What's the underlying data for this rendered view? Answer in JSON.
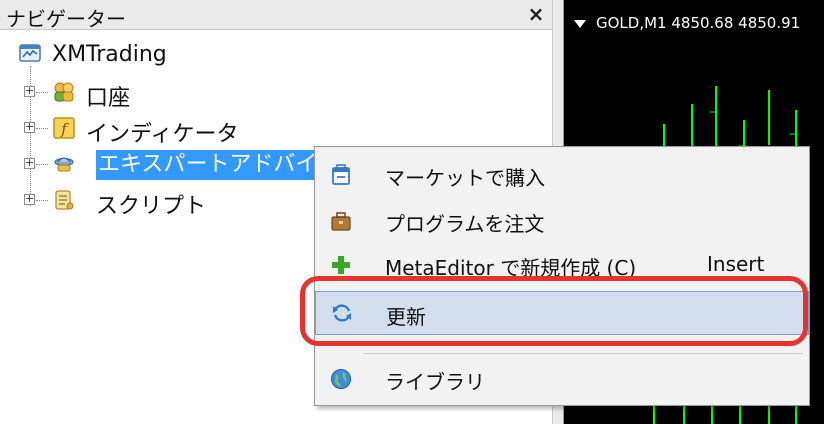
{
  "navigator": {
    "title": "ナビゲーター",
    "close_glyph": "×",
    "root": {
      "label": "XMTrading",
      "icon": "terminal-icon"
    },
    "items": [
      {
        "label": "口座",
        "icon": "accounts-icon"
      },
      {
        "label": "インディケータ",
        "icon": "indicator-icon"
      },
      {
        "label": "エキスパートアドバイザ",
        "icon": "expert-advisor-icon",
        "selected": true
      },
      {
        "label": "スクリプト",
        "icon": "script-icon"
      }
    ]
  },
  "chart": {
    "title": "GOLD,M1  4850.68 4850.91",
    "background": "#000000",
    "candle_color": "#00ff00"
  },
  "context_menu": {
    "items": [
      {
        "label": "マーケットで購入",
        "icon": "market-bag-icon",
        "shortcut": ""
      },
      {
        "label": "プログラムを注文",
        "icon": "briefcase-icon",
        "shortcut": ""
      },
      {
        "label": "MetaEditor で新規作成 (C)",
        "icon": "plus-icon",
        "shortcut": "Insert"
      },
      {
        "label": "更新",
        "icon": "refresh-icon",
        "shortcut": "",
        "hovered": true
      },
      {
        "label": "ライブラリ",
        "icon": "globe-icon",
        "shortcut": ""
      }
    ]
  },
  "colors": {
    "selection": "#3399ff",
    "menu_hover": "#d3dfee",
    "highlight_ring": "#e8322f"
  }
}
